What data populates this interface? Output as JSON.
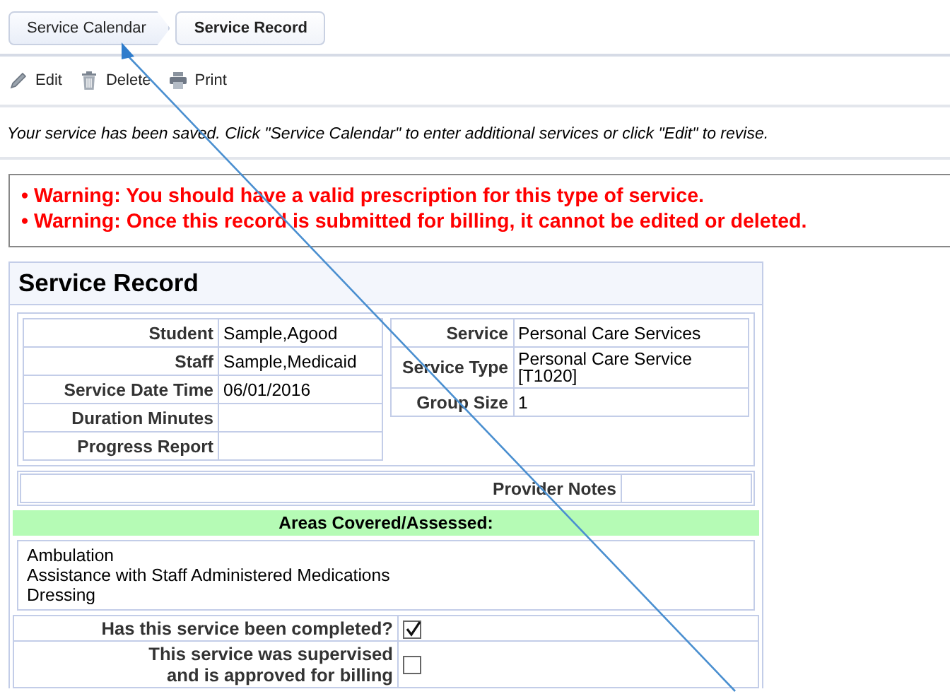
{
  "breadcrumbs": [
    {
      "label": "Service Calendar",
      "selected": false
    },
    {
      "label": "Service Record",
      "selected": true
    }
  ],
  "toolbar": [
    {
      "kind": "edit",
      "label": "Edit"
    },
    {
      "kind": "delete",
      "label": "Delete"
    },
    {
      "kind": "print",
      "label": "Print"
    }
  ],
  "message": "Your service has been saved. Click \"Service Calendar\" to enter additional services or click \"Edit\" to revise.",
  "warnings": [
    "• Warning: You should have a valid prescription for this type of service.",
    "• Warning: Once this record is submitted for billing, it cannot be edited or deleted."
  ],
  "record": {
    "title": "Service Record",
    "left_fields": [
      {
        "label": "Student",
        "value": "Sample,Agood"
      },
      {
        "label": "Staff",
        "value": "Sample,Medicaid"
      },
      {
        "label": "Service Date Time",
        "value": "06/01/2016"
      },
      {
        "label": "Duration Minutes"
      },
      {
        "label": "Progress Report"
      }
    ],
    "right_fields": [
      {
        "label": "Service",
        "value": "Personal Care Services"
      },
      {
        "label": "Service Type",
        "value": "Personal Care Service\n[T1020]"
      },
      {
        "label": "Group Size",
        "value": "1"
      }
    ],
    "provider_notes_label": "Provider Notes",
    "areas_heading": "Areas Covered/Assessed:",
    "areas": [
      "Ambulation",
      "Assistance with Staff Administered Medications",
      "Dressing"
    ],
    "questions": [
      {
        "label": "Has this service been completed?",
        "checked": true
      },
      {
        "label": "This service was supervised\nand is approved for billing",
        "checked": false
      }
    ]
  }
}
